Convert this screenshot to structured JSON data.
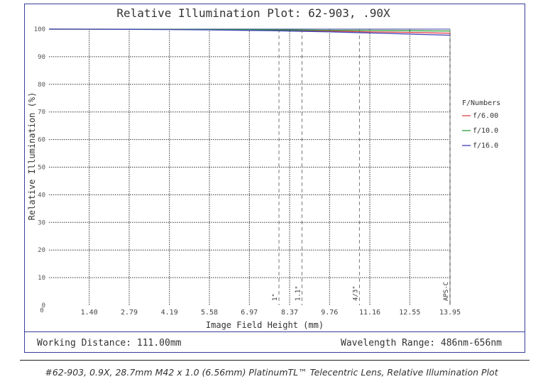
{
  "chart_data": {
    "type": "line",
    "title": "Relative Illumination Plot: 62-903, .90X",
    "xlabel": "Image Field Height (mm)",
    "ylabel": "Relative Illumination (%)",
    "xlim": [
      0,
      13.95
    ],
    "ylim": [
      0,
      100
    ],
    "x_ticks": [
      "1.40",
      "2.79",
      "4.19",
      "5.58",
      "6.97",
      "8.37",
      "9.76",
      "11.16",
      "12.55",
      "13.95"
    ],
    "y_ticks": [
      "0",
      "10",
      "20",
      "30",
      "40",
      "50",
      "60",
      "70",
      "80",
      "90",
      "100"
    ],
    "grid": true,
    "legend_title": "F/Numbers",
    "legend_position": "right",
    "series": [
      {
        "name": "f/6.00",
        "color": "#e0404a",
        "x": [
          0,
          1.4,
          2.79,
          4.19,
          5.58,
          6.97,
          8.37,
          9.76,
          11.16,
          12.55,
          13.95
        ],
        "y": [
          100,
          99.98,
          99.95,
          99.9,
          99.8,
          99.7,
          99.5,
          99.3,
          99.0,
          98.8,
          98.5
        ]
      },
      {
        "name": "f/10.0",
        "color": "#2e9e3c",
        "x": [
          0,
          1.4,
          2.79,
          4.19,
          5.58,
          6.97,
          8.37,
          9.76,
          11.16,
          12.55,
          13.95
        ],
        "y": [
          100,
          99.99,
          99.97,
          99.93,
          99.87,
          99.8,
          99.7,
          99.6,
          99.5,
          99.4,
          99.3
        ]
      },
      {
        "name": "f/16.0",
        "color": "#3a3fb5",
        "x": [
          0,
          1.4,
          2.79,
          4.19,
          5.58,
          6.97,
          8.37,
          9.76,
          11.16,
          12.55,
          13.95
        ],
        "y": [
          100,
          99.98,
          99.93,
          99.85,
          99.72,
          99.55,
          99.3,
          99.0,
          98.6,
          98.2,
          97.8
        ]
      }
    ],
    "sensor_markers": [
      {
        "label": "1\"",
        "x": 8.0
      },
      {
        "label": "1.1\"",
        "x": 8.8
      },
      {
        "label": "4/3\"",
        "x": 10.8
      },
      {
        "label": "APS-C",
        "x": 13.95
      }
    ]
  },
  "footer": {
    "working_distance": "Working Distance: 111.00mm",
    "wavelength_range": "Wavelength Range: 486nm-656nm"
  },
  "caption": "#62-903, 0.9X, 28.7mm M42 x 1.0 (6.56mm) PlatinumTL™ Telecentric Lens, Relative Illumination Plot"
}
